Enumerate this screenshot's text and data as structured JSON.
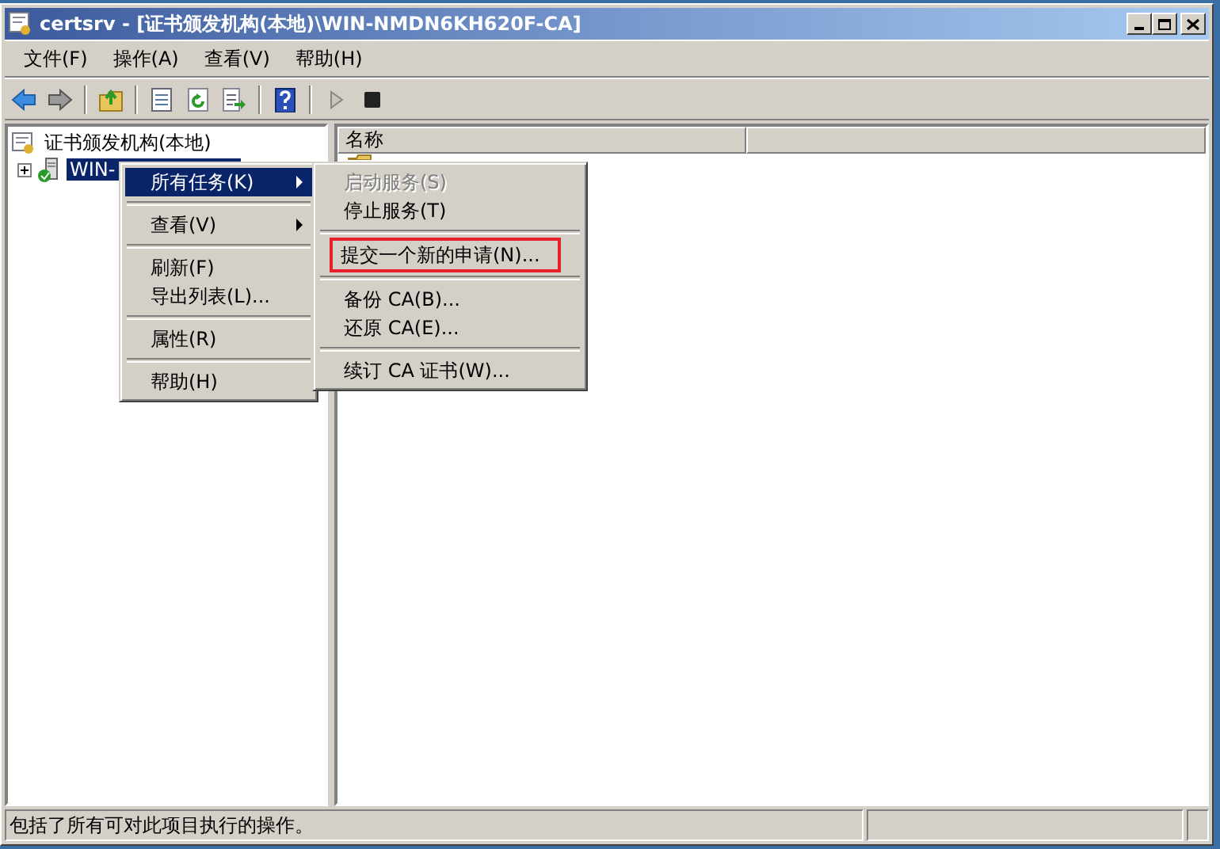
{
  "window": {
    "title": "certsrv - [证书颁发机构(本地)\\WIN-NMDN6KH620F-CA]"
  },
  "menu_bar": [
    "文件(F)",
    "操作(A)",
    "查看(V)",
    "帮助(H)"
  ],
  "toolbar": [
    {
      "kind": "back",
      "disabled": false
    },
    {
      "kind": "forward",
      "disabled": true
    },
    {
      "kind": "separator"
    },
    {
      "kind": "up"
    },
    {
      "kind": "separator"
    },
    {
      "kind": "properties"
    },
    {
      "kind": "refresh"
    },
    {
      "kind": "export"
    },
    {
      "kind": "separator"
    },
    {
      "kind": "help"
    },
    {
      "kind": "separator"
    },
    {
      "kind": "play",
      "disabled": true
    },
    {
      "kind": "stop",
      "disabled": false
    }
  ],
  "tree": [
    {
      "label": "证书颁发机构(本地)",
      "selected": false,
      "children": [
        {
          "label": "WIN-",
          "selected": true,
          "expanded": false
        }
      ]
    }
  ],
  "list": {
    "columns": [
      "名称"
    ]
  },
  "context_menu": [
    {
      "kind": "item",
      "label": "所有任务(K)",
      "submenu": true,
      "selected": true
    },
    {
      "kind": "separator"
    },
    {
      "kind": "item",
      "label": "查看(V)",
      "submenu": true,
      "selected": false
    },
    {
      "kind": "separator"
    },
    {
      "kind": "item",
      "label": "刷新(F)",
      "submenu": false,
      "selected": false
    },
    {
      "kind": "item",
      "label": "导出列表(L)...",
      "submenu": false,
      "selected": false
    },
    {
      "kind": "separator"
    },
    {
      "kind": "item",
      "label": "属性(R)",
      "submenu": false,
      "selected": false
    },
    {
      "kind": "separator"
    },
    {
      "kind": "item",
      "label": "帮助(H)",
      "submenu": false,
      "selected": false
    }
  ],
  "submenu": [
    {
      "kind": "item",
      "label": "启动服务(S)",
      "disabled": true,
      "highlighted": false
    },
    {
      "kind": "item",
      "label": "停止服务(T)",
      "disabled": false,
      "highlighted": false
    },
    {
      "kind": "separator"
    },
    {
      "kind": "item",
      "label": "提交一个新的申请(N)...",
      "disabled": false,
      "highlighted": true
    },
    {
      "kind": "separator"
    },
    {
      "kind": "item",
      "label": "备份 CA(B)...",
      "disabled": false,
      "highlighted": false
    },
    {
      "kind": "item",
      "label": "还原 CA(E)...",
      "disabled": false,
      "highlighted": false
    },
    {
      "kind": "separator"
    },
    {
      "kind": "item",
      "label": "续订 CA 证书(W)...",
      "disabled": false,
      "highlighted": false
    }
  ],
  "status_bar": "包括了所有可对此项目执行的操作。"
}
